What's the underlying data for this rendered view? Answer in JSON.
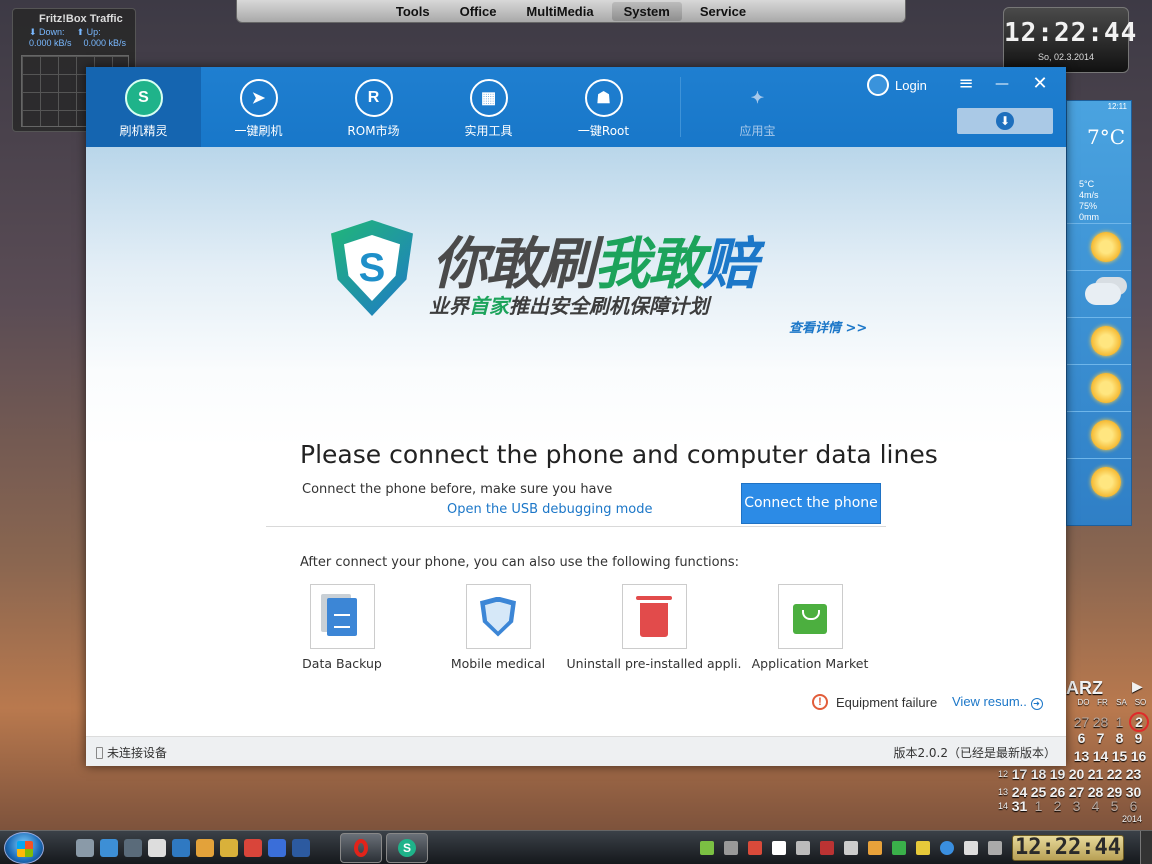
{
  "desktop": {
    "top_menu": [
      "Tools",
      "Office",
      "MultiMedia",
      "System",
      "Service"
    ],
    "top_menu_active": "System",
    "fritz": {
      "title": "Fritz!Box Traffic",
      "down_label": "Down:",
      "up_label": "Up:",
      "down_value": "0.000 kB/s",
      "up_value": "0.000 kB/s"
    },
    "clock": {
      "time": "12:22:44",
      "date": "So, 02.3.2014"
    },
    "weather": {
      "time": "12:11",
      "temp": "7°C",
      "details": [
        "5°C",
        "4m/s",
        "75%",
        "0mm"
      ],
      "days": [
        "sun-icon",
        "rain-cloud-icon",
        "sun-icon",
        "sun-icon",
        "sun-icon",
        "sun-icon"
      ]
    },
    "calendar": {
      "month": "ARZ",
      "weekday_headers": [
        "DO",
        "FR",
        "SA",
        "SO"
      ],
      "rows": [
        {
          "week": "",
          "days": [
            "27",
            "28",
            "1",
            "2"
          ]
        },
        {
          "week": "",
          "days": [
            "6",
            "7",
            "8",
            "9"
          ]
        },
        {
          "week": "",
          "days": [
            "13",
            "14",
            "15",
            "16"
          ]
        },
        {
          "week": "12",
          "days": [
            "17",
            "18",
            "19",
            "20",
            "21",
            "22",
            "23"
          ]
        },
        {
          "week": "13",
          "days": [
            "24",
            "25",
            "26",
            "27",
            "28",
            "29",
            "30"
          ]
        },
        {
          "week": "14",
          "days": [
            "31",
            "1",
            "2",
            "3",
            "4",
            "5",
            "6"
          ]
        }
      ],
      "year": "2014",
      "today": "2"
    }
  },
  "taskbar": {
    "clock": "12:22:44"
  },
  "app": {
    "nav": [
      {
        "label": "刷机精灵",
        "glyph": "S",
        "icon": "shield-s-icon"
      },
      {
        "label": "一键刷机",
        "glyph": "➤",
        "icon": "cursor-icon"
      },
      {
        "label": "ROM市场",
        "glyph": "R",
        "icon": "rom-icon"
      },
      {
        "label": "实用工具",
        "glyph": "▦",
        "icon": "tools-grid-icon"
      },
      {
        "label": "一键Root",
        "glyph": "☗",
        "icon": "android-icon"
      },
      {
        "label": "应用宝",
        "glyph": "✦",
        "icon": "app-store-icon"
      }
    ],
    "login_label": "Login",
    "window_controls": {
      "menu": "≡",
      "minimize": "—",
      "close": "✕"
    },
    "download_glyph": "⬇",
    "banner": {
      "slogan_part1": "你敢刷",
      "slogan_part2": "我敢",
      "slogan_part3": "赔",
      "sub_part1": "业界",
      "sub_highlight": "首家",
      "sub_part2": "推出安全刷机保障计划",
      "detail_link": "查看详情 >>"
    },
    "heading": "Please connect the phone and computer data lines",
    "pre_text": "Connect the phone before, make sure you have",
    "usb_link": "Open the USB debugging mode",
    "connect_button": "Connect the phone",
    "after_text": "After connect your phone, you can also use the following functions:",
    "functions": [
      {
        "label": "Data Backup",
        "icon": "document-icon"
      },
      {
        "label": "Mobile medical",
        "icon": "shield-icon"
      },
      {
        "label": "Uninstall pre-installed appli.",
        "icon": "trash-icon"
      },
      {
        "label": "Application Market",
        "icon": "shopping-bag-icon"
      }
    ],
    "failure_text": "Equipment failure",
    "resume_link": "View resum..",
    "status_left": "未连接设备",
    "status_right": "版本2.0.2（已经是最新版本）"
  }
}
